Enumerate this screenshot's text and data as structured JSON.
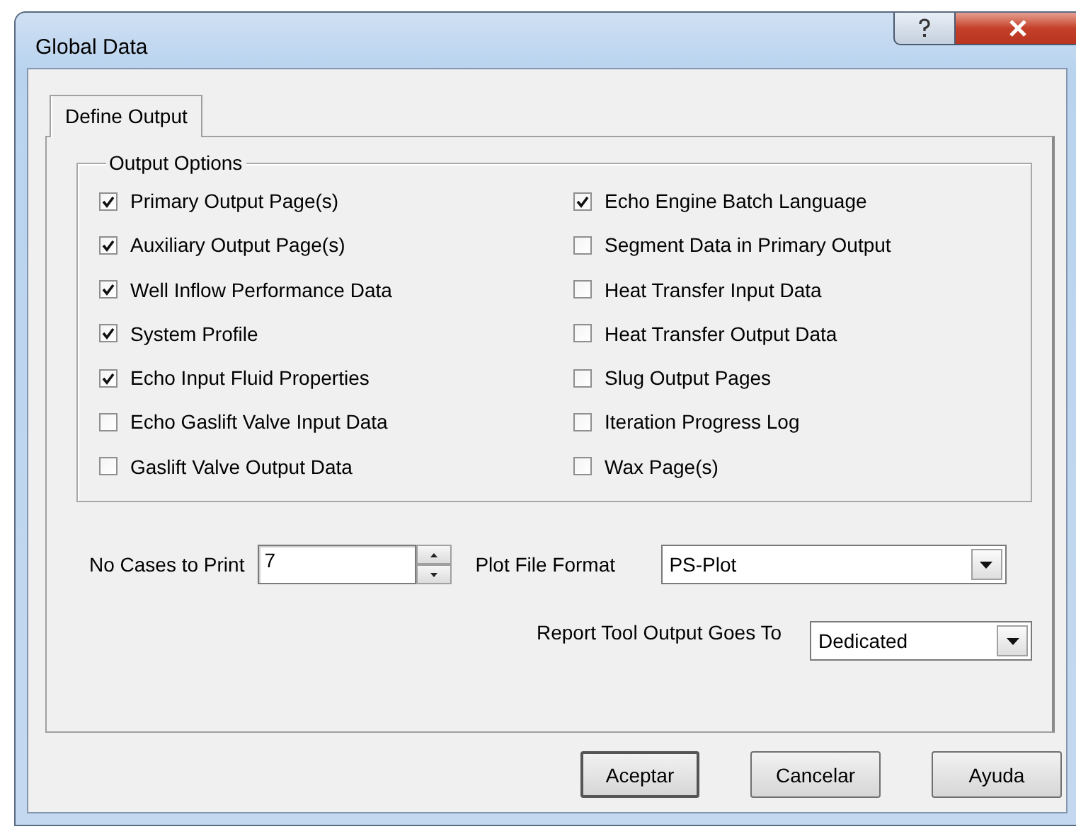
{
  "window": {
    "title": "Global Data"
  },
  "tabs": [
    {
      "label": "Define Output",
      "selected": true
    }
  ],
  "output_options": {
    "title": "Output Options",
    "items": [
      {
        "label": "Primary Output Page(s)",
        "checked": true
      },
      {
        "label": "Auxiliary Output Page(s)",
        "checked": true
      },
      {
        "label": "Well Inflow Performance Data",
        "checked": true
      },
      {
        "label": "System Profile",
        "checked": true
      },
      {
        "label": "Echo Input Fluid Properties",
        "checked": true
      },
      {
        "label": "Echo Gaslift Valve Input Data",
        "checked": false
      },
      {
        "label": "Gaslift Valve Output Data",
        "checked": false
      },
      {
        "label": "Echo Engine Batch Language",
        "checked": true
      },
      {
        "label": "Segment Data in Primary Output",
        "checked": false
      },
      {
        "label": "Heat Transfer Input Data",
        "checked": false
      },
      {
        "label": "Heat Transfer Output Data",
        "checked": false
      },
      {
        "label": "Slug Output Pages",
        "checked": false
      },
      {
        "label": "Iteration Progress Log",
        "checked": false
      },
      {
        "label": "Wax Page(s)",
        "checked": false
      }
    ]
  },
  "cases_to_print": {
    "label": "No Cases to Print",
    "value": "7"
  },
  "plot_file_format": {
    "label": "Plot File Format",
    "value": "PS-Plot"
  },
  "report_tool_output": {
    "label": "Report Tool Output Goes To",
    "value": "Dedicated"
  },
  "buttons": [
    {
      "label": "Aceptar",
      "default": true
    },
    {
      "label": "Cancelar",
      "default": false
    },
    {
      "label": "Ayuda",
      "default": false
    }
  ]
}
